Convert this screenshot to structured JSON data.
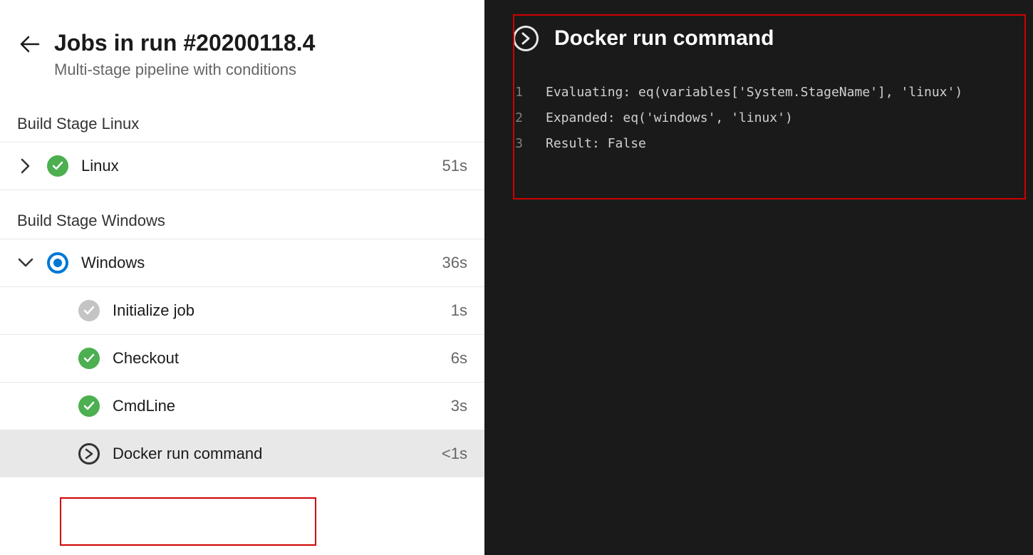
{
  "header": {
    "title": "Jobs in run #20200118.4",
    "subtitle": "Multi-stage pipeline with conditions"
  },
  "stages": [
    {
      "name": "Build Stage Linux",
      "jobs": [
        {
          "name": "Linux",
          "status": "success",
          "duration": "51s",
          "expanded": false,
          "tasks": []
        }
      ]
    },
    {
      "name": "Build Stage Windows",
      "jobs": [
        {
          "name": "Windows",
          "status": "running",
          "duration": "36s",
          "expanded": true,
          "tasks": [
            {
              "name": "Initialize job",
              "status": "neutral",
              "duration": "1s",
              "selected": false
            },
            {
              "name": "Checkout",
              "status": "success",
              "duration": "6s",
              "selected": false
            },
            {
              "name": "CmdLine",
              "status": "success",
              "duration": "3s",
              "selected": false
            },
            {
              "name": "Docker run command",
              "status": "skipped",
              "duration": "<1s",
              "selected": true
            }
          ]
        }
      ]
    }
  ],
  "detail": {
    "title": "Docker run command",
    "log": [
      {
        "n": "1",
        "text": "Evaluating: eq(variables['System.StageName'], 'linux')"
      },
      {
        "n": "2",
        "text": "Expanded: eq('windows', 'linux')"
      },
      {
        "n": "3",
        "text": "Result: False"
      }
    ]
  }
}
